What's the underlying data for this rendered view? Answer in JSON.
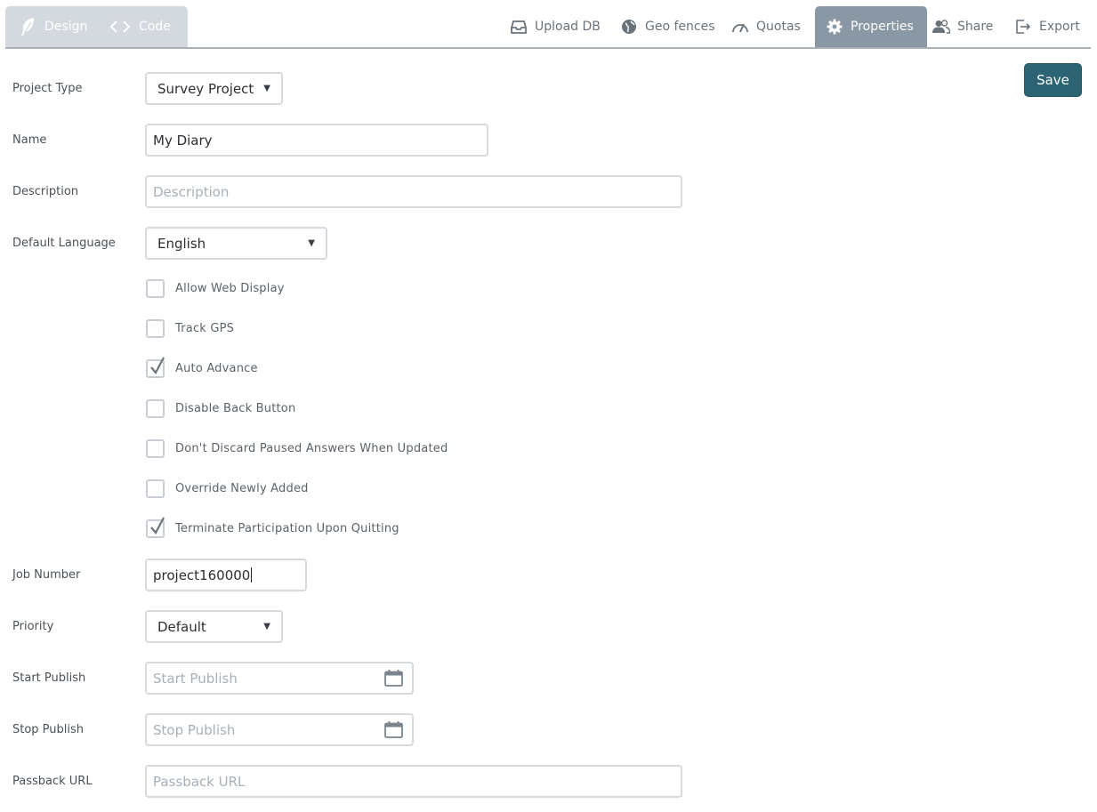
{
  "tabs": {
    "left": [
      {
        "label": "Design",
        "icon": "feather-icon"
      },
      {
        "label": "Code",
        "icon": "code-brackets-icon"
      }
    ],
    "right": [
      {
        "label": "Upload DB",
        "icon": "inbox-tray-icon"
      },
      {
        "label": "Geo fences",
        "icon": "globe-icon"
      },
      {
        "label": "Quotas",
        "icon": "gauge-icon"
      },
      {
        "label": "Properties",
        "icon": "gear-icon",
        "active": true
      },
      {
        "label": "Share",
        "icon": "users-icon"
      },
      {
        "label": "Export",
        "icon": "export-icon"
      }
    ]
  },
  "actions": {
    "save_label": "Save"
  },
  "colors": {
    "save_bg": "#2d6473",
    "active_tab_bg": "#8a98a5",
    "left_tabs_bg": "#d3d9de"
  },
  "form": {
    "project_type": {
      "label": "Project Type",
      "value": "Survey Project"
    },
    "name": {
      "label": "Name",
      "value": "My Diary"
    },
    "description": {
      "label": "Description",
      "placeholder": "Description"
    },
    "default_language": {
      "label": "Default Language",
      "value": "English"
    },
    "checkboxes": [
      {
        "label": "Allow Web Display",
        "checked": false
      },
      {
        "label": "Track GPS",
        "checked": false
      },
      {
        "label": "Auto Advance",
        "checked": true
      },
      {
        "label": "Disable Back Button",
        "checked": false
      },
      {
        "label": "Don't Discard Paused Answers When Updated",
        "checked": false
      },
      {
        "label": "Override Newly Added",
        "checked": false
      },
      {
        "label": "Terminate Participation Upon Quitting",
        "checked": true
      }
    ],
    "job_number": {
      "label": "Job Number",
      "value": "project160000"
    },
    "priority": {
      "label": "Priority",
      "value": "Default"
    },
    "start_publish": {
      "label": "Start Publish",
      "placeholder": "Start Publish",
      "icon": "calendar-icon"
    },
    "stop_publish": {
      "label": "Stop Publish",
      "placeholder": "Stop Publish",
      "icon": "calendar-icon"
    },
    "passback_url": {
      "label": "Passback URL",
      "placeholder": "Passback URL"
    }
  }
}
